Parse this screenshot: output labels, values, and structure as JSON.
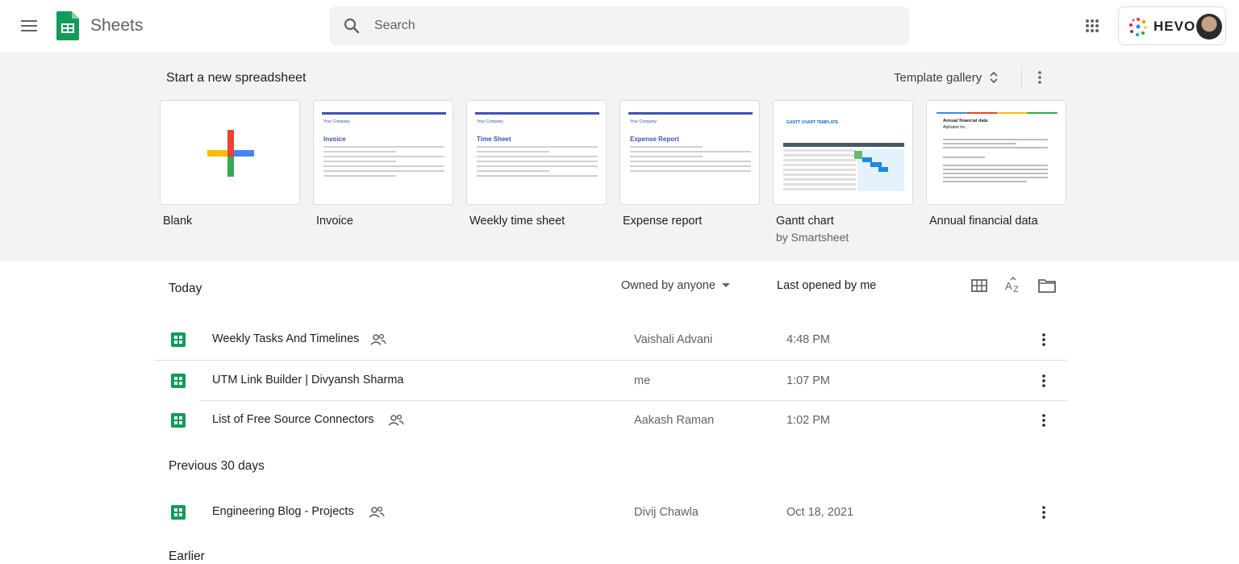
{
  "header": {
    "app_name": "Sheets",
    "search_placeholder": "Search",
    "account_brand": "HEVO"
  },
  "templates": {
    "heading": "Start a new spreadsheet",
    "gallery_label": "Template gallery",
    "items": [
      {
        "label": "Blank",
        "sub": ""
      },
      {
        "label": "Invoice",
        "sub": "",
        "thumb_title": "Invoice",
        "thumb_company": "Your Company"
      },
      {
        "label": "Weekly time sheet",
        "sub": "",
        "thumb_title": "Time Sheet",
        "thumb_company": "Your Company"
      },
      {
        "label": "Expense report",
        "sub": "",
        "thumb_title": "Expense Report",
        "thumb_company": "Your Company"
      },
      {
        "label": "Gantt chart",
        "sub": "by Smartsheet",
        "thumb_title": "GANTT CHART TEMPLATE"
      },
      {
        "label": "Annual financial data",
        "sub": "",
        "thumb_title": "Annual financial data",
        "thumb_company": "Alphabet Inc."
      }
    ]
  },
  "list": {
    "owned_by": "Owned by anyone",
    "sort_by": "Last opened by me",
    "sections": [
      {
        "title": "Today"
      },
      {
        "title": "Previous 30 days"
      },
      {
        "title": "Earlier"
      }
    ],
    "files": [
      {
        "name": "Weekly Tasks And Timelines",
        "owner": "Vaishali Advani",
        "date": "4:48 PM",
        "shared": true
      },
      {
        "name": "UTM Link Builder | Divyansh Sharma",
        "owner": "me",
        "date": "1:07 PM",
        "shared": false
      },
      {
        "name": "List of Free Source Connectors",
        "owner": "Aakash Raman",
        "date": "1:02 PM",
        "shared": true
      },
      {
        "name": "Engineering Blog - Projects",
        "owner": "Divij Chawla",
        "date": "Oct 18, 2021",
        "shared": true
      }
    ]
  },
  "colors": {
    "sheets_green": "#0f9d58",
    "template_bg": "#f1f3f4",
    "accent_blue": "#3f51b5"
  }
}
